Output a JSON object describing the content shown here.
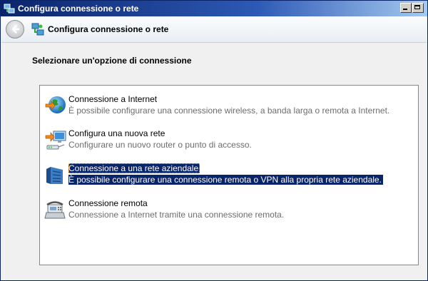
{
  "window": {
    "title": "Configura connessione o rete"
  },
  "nav": {
    "title": "Configura connessione o rete"
  },
  "heading": "Selezionare un'opzione di connessione",
  "options": [
    {
      "title": "Connessione a Internet",
      "description": "È possibile configurare una connessione wireless, a banda larga o remota a Internet.",
      "icon": "globe-icon",
      "selected": false
    },
    {
      "title": "Configura una nuova rete",
      "description": "Configurare un nuovo router o punto di accesso.",
      "icon": "network-icon",
      "selected": false
    },
    {
      "title": "Connessione a una rete aziendale",
      "description": "È possibile configurare una connessione remota o VPN alla propria rete aziendale.",
      "icon": "workplace-icon",
      "selected": true
    },
    {
      "title": "Connessione remota",
      "description": "Connessione a Internet tramite una connessione remota.",
      "icon": "phone-icon",
      "selected": false
    }
  ],
  "colors": {
    "selection": "#0a246a",
    "description_text": "#6d6d6d"
  }
}
